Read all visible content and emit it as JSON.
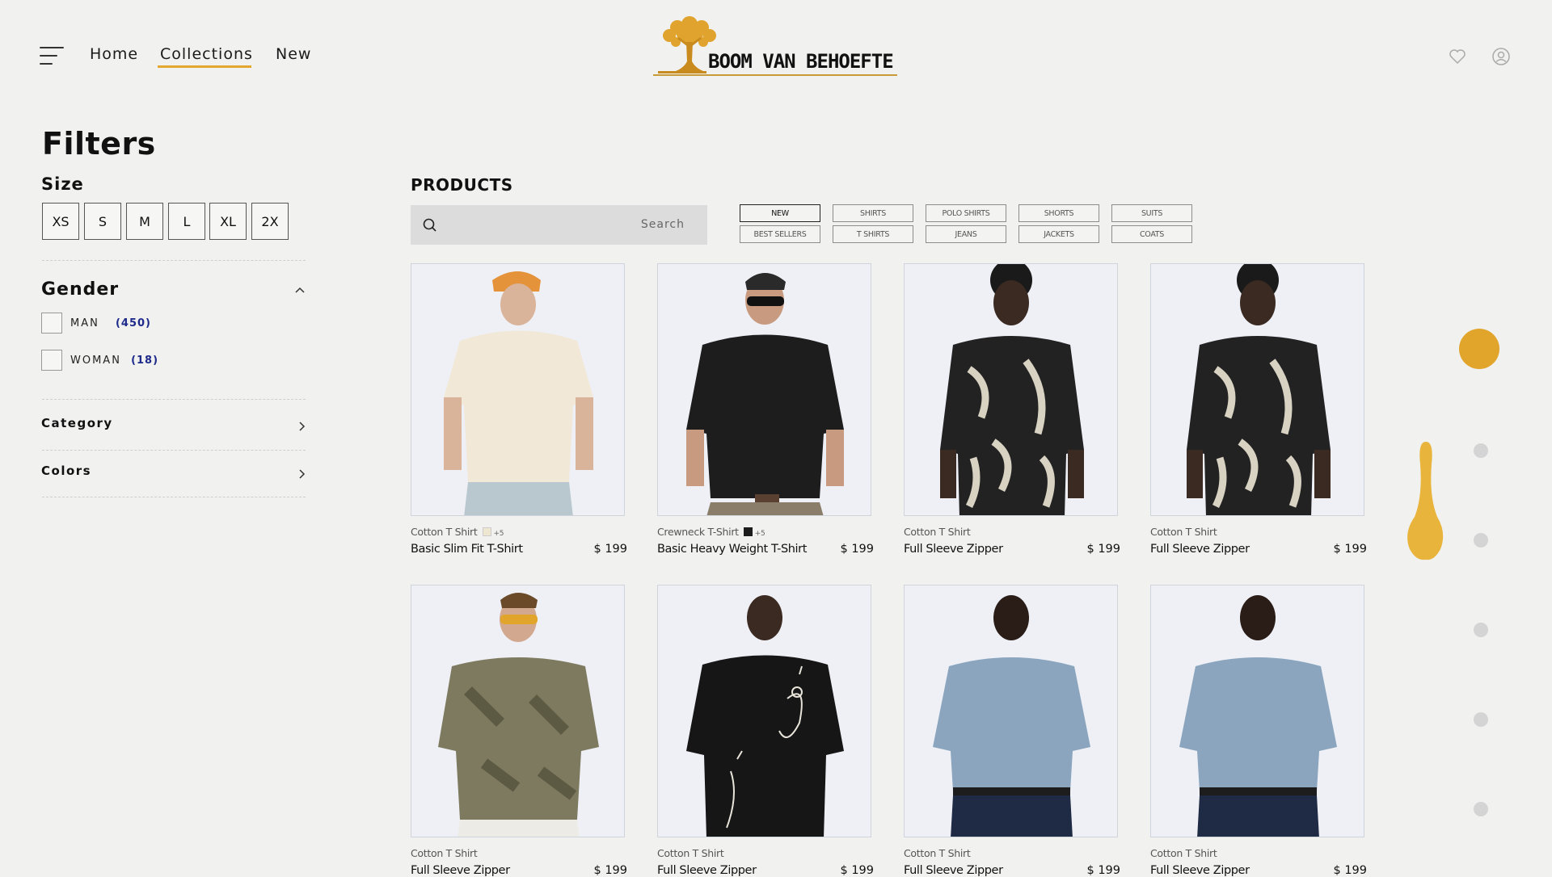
{
  "header": {
    "nav": [
      "Home",
      "Collections",
      "New"
    ],
    "active_nav": "Collections",
    "logo_text": "BOOM VAN BEHOEFTE"
  },
  "filters": {
    "title": "Filters",
    "size": {
      "label": "Size",
      "options": [
        "XS",
        "S",
        "M",
        "L",
        "XL",
        "2X"
      ]
    },
    "gender": {
      "label": "Gender",
      "options": [
        {
          "label": "MAN",
          "count": "(450)"
        },
        {
          "label": "WOMAN",
          "count": "(18)"
        }
      ]
    },
    "category_label": "Category",
    "colors_label": "Colors"
  },
  "products": {
    "title": "PRODUCTS",
    "search_placeholder": "Search",
    "categories": [
      [
        "NEW",
        "SHIRTS",
        "POLO SHIRTS",
        "SHORTS",
        "SUITS"
      ],
      [
        "BEST SELLERS",
        "T SHIRTS",
        "JEANS",
        "JACKETS",
        "COATS"
      ]
    ],
    "active_category": "NEW",
    "items": [
      {
        "sub": "Cotton T Shirt",
        "name": "Basic Slim Fit T-Shirt",
        "price": "$ 199",
        "swatch": "#efe6d2",
        "more": "+5"
      },
      {
        "sub": "Crewneck T-Shirt",
        "name": "Basic Heavy Weight T-Shirt",
        "price": "$ 199",
        "swatch": "#1c1c1c",
        "more": "+5"
      },
      {
        "sub": "Cotton T Shirt",
        "name": "Full Sleeve Zipper",
        "price": "$ 199"
      },
      {
        "sub": "Cotton T Shirt",
        "name": "Full Sleeve Zipper",
        "price": "$ 199"
      },
      {
        "sub": "Cotton T Shirt",
        "name": "Full Sleeve Zipper",
        "price": "$ 199"
      },
      {
        "sub": "Cotton T Shirt",
        "name": "Full Sleeve Zipper",
        "price": "$ 199"
      },
      {
        "sub": "Cotton T Shirt",
        "name": "Full Sleeve Zipper",
        "price": "$ 199"
      },
      {
        "sub": "Cotton T Shirt",
        "name": "Full Sleeve Zipper",
        "price": "$ 199"
      }
    ]
  },
  "colors": {
    "accent": "#e3a72f",
    "background": "#f1f1f0",
    "count_blue": "#1e2a8a"
  },
  "icons": [
    "menu-icon",
    "tree-logo-icon",
    "heart-icon",
    "user-icon",
    "search-icon",
    "chevron-up-icon",
    "chevron-right-icon"
  ]
}
